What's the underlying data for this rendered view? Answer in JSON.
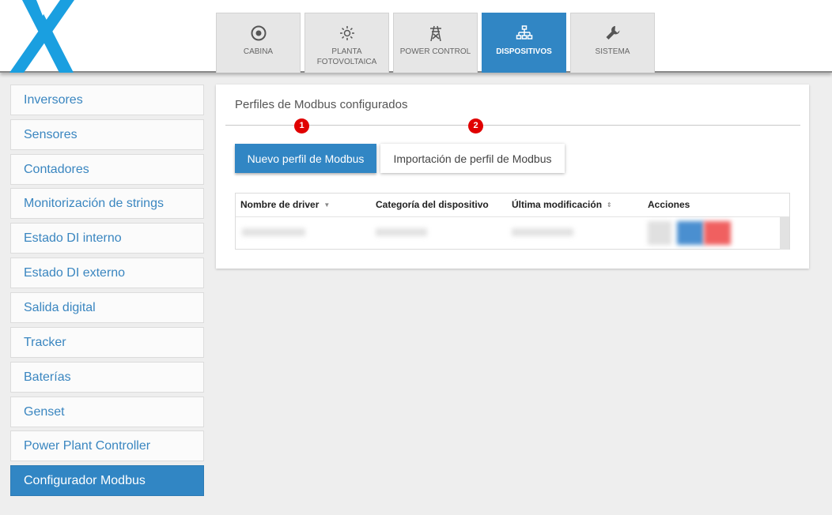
{
  "nav": {
    "tabs": [
      {
        "label": "CABINA",
        "icon": "target-icon"
      },
      {
        "label": "PLANTA FOTOVOLTAICA",
        "icon": "sun-icon"
      },
      {
        "label": "POWER CONTROL",
        "icon": "power-tower-icon"
      },
      {
        "label": "DISPOSITIVOS",
        "icon": "network-icon",
        "active": true
      },
      {
        "label": "SISTEMA",
        "icon": "wrench-icon"
      }
    ]
  },
  "sidebar": {
    "items": [
      {
        "label": "Inversores"
      },
      {
        "label": "Sensores"
      },
      {
        "label": "Contadores"
      },
      {
        "label": "Monitorización de strings"
      },
      {
        "label": "Estado DI interno"
      },
      {
        "label": "Estado DI externo"
      },
      {
        "label": "Salida digital"
      },
      {
        "label": "Tracker"
      },
      {
        "label": "Baterías"
      },
      {
        "label": "Genset"
      },
      {
        "label": "Power Plant Controller"
      },
      {
        "label": "Configurador Modbus",
        "active": true
      }
    ]
  },
  "main": {
    "title": "Perfiles de Modbus configurados",
    "badges": [
      "1",
      "2"
    ],
    "new_profile_label": "Nuevo perfil de Modbus",
    "import_profile_label": "Importación de perfil de Modbus",
    "table": {
      "columns": [
        "Nombre de driver",
        "Categoría del dispositivo",
        "Última modificación",
        "Acciones"
      ]
    }
  },
  "colors": {
    "accent": "#3186c4",
    "badge": "#e00000",
    "logo": "#1a9fe0"
  }
}
